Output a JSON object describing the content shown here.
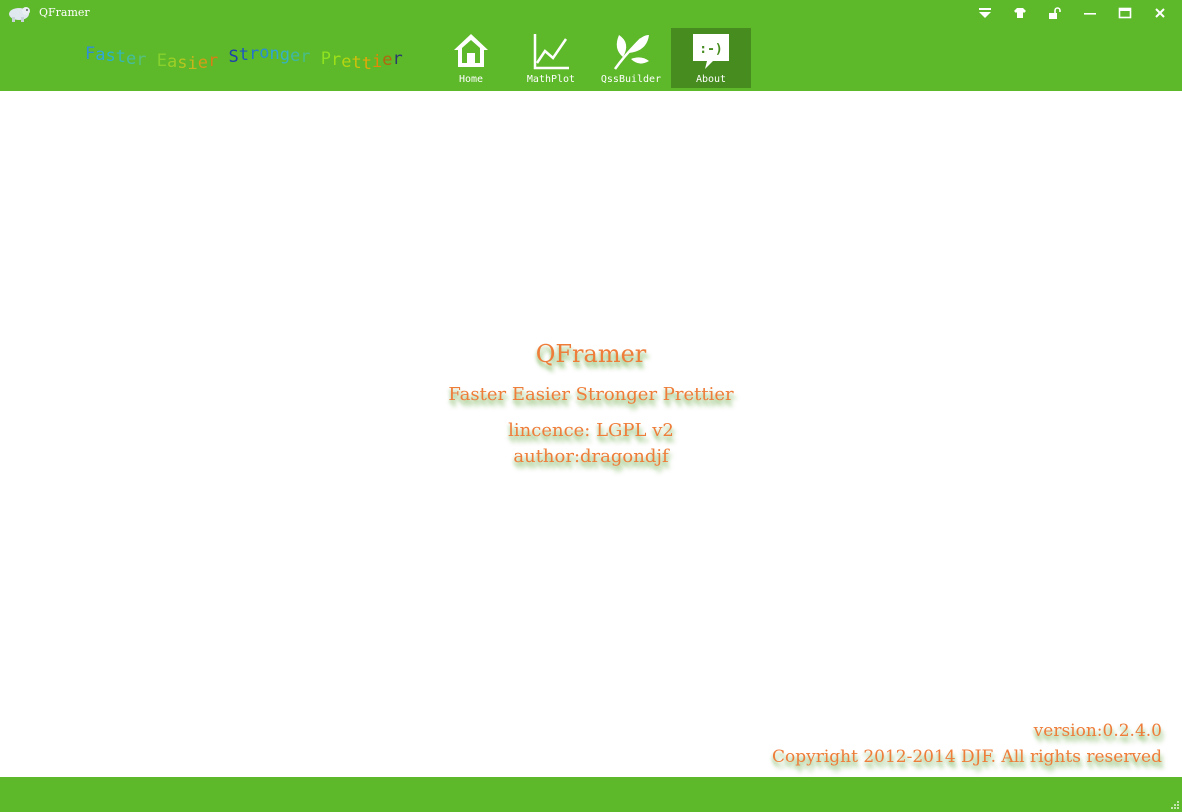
{
  "window": {
    "title": "QFramer",
    "controls": [
      {
        "name": "dropdown-menu-icon"
      },
      {
        "name": "skin-tshirt-icon"
      },
      {
        "name": "unlock-icon"
      },
      {
        "name": "minimize-icon"
      },
      {
        "name": "maximize-icon"
      },
      {
        "name": "close-icon"
      }
    ]
  },
  "slogan": {
    "letters": [
      {
        "ch": "F",
        "color": "#2f8fd6"
      },
      {
        "ch": "a",
        "color": "#31a6d8"
      },
      {
        "ch": "s",
        "color": "#2ab3cc"
      },
      {
        "ch": "t",
        "color": "#35b7b8"
      },
      {
        "ch": "e",
        "color": "#45bda0"
      },
      {
        "ch": "r",
        "color": "#56c07e"
      },
      {
        "ch": " ",
        "color": "#ffffff"
      },
      {
        "ch": "E",
        "color": "#86d12d"
      },
      {
        "ch": "a",
        "color": "#9ccf27"
      },
      {
        "ch": "s",
        "color": "#b7c521"
      },
      {
        "ch": "i",
        "color": "#c9b51c"
      },
      {
        "ch": "e",
        "color": "#d69c18"
      },
      {
        "ch": "r",
        "color": "#d97e16"
      },
      {
        "ch": " ",
        "color": "#ffffff"
      },
      {
        "ch": "S",
        "color": "#1c3fae"
      },
      {
        "ch": "t",
        "color": "#1d57c0"
      },
      {
        "ch": "r",
        "color": "#2474d0"
      },
      {
        "ch": "o",
        "color": "#2a8fd6"
      },
      {
        "ch": "n",
        "color": "#2fa5d6"
      },
      {
        "ch": "g",
        "color": "#36b2c5"
      },
      {
        "ch": "e",
        "color": "#40b7a6"
      },
      {
        "ch": "r",
        "color": "#49bd88"
      },
      {
        "ch": " ",
        "color": "#ffffff"
      },
      {
        "ch": "P",
        "color": "#8ee21f"
      },
      {
        "ch": "r",
        "color": "#9fe018"
      },
      {
        "ch": "e",
        "color": "#b5d512"
      },
      {
        "ch": "t",
        "color": "#d0c00c"
      },
      {
        "ch": "t",
        "color": "#e6a80a"
      },
      {
        "ch": "i",
        "color": "#e38808"
      },
      {
        "ch": "e",
        "color": "#b3660e"
      },
      {
        "ch": "r",
        "color": "#2b3a6d"
      }
    ]
  },
  "nav": {
    "buttons": [
      {
        "label": "Home",
        "icon": "home-icon"
      },
      {
        "label": "MathPlot",
        "icon": "line-chart-icon"
      },
      {
        "label": "QssBuilder",
        "icon": "leaf-icon"
      },
      {
        "label": "About",
        "icon": "speech-bubble-smiley-icon",
        "active": true
      }
    ]
  },
  "about": {
    "app_name": "QFramer",
    "tagline": "Faster Easier Stronger Prettier",
    "licence": "lincence: LGPL v2",
    "author": "author:dragondjf",
    "icon_text": ":-)"
  },
  "footer": {
    "version": "version:0.2.4.0",
    "copyright": "Copyright 2012-2014 DJF. All rights reserved"
  },
  "colors": {
    "accent": "#5db82a",
    "accent_active": "#468c1f",
    "text_orange": "#ef7d3a"
  }
}
